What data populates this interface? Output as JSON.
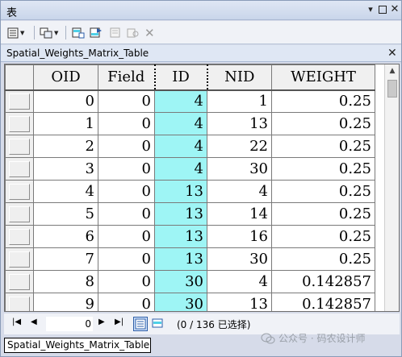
{
  "window": {
    "title": "表"
  },
  "toolbar": {
    "buttons": [
      {
        "icon": "table-options-icon"
      },
      {
        "icon": "related-tables-icon"
      },
      {
        "icon": "select-by-attributes-icon"
      },
      {
        "icon": "switch-selection-icon"
      },
      {
        "icon": "clear-selection-icon"
      },
      {
        "icon": "zoom-to-selected-icon"
      },
      {
        "icon": "delete-selected-icon"
      }
    ]
  },
  "tab": {
    "title": "Spatial_Weights_Matrix_Table"
  },
  "grid": {
    "columns": [
      "OID",
      "Field",
      "ID",
      "NID",
      "WEIGHT"
    ],
    "selected_column": "ID",
    "rows": [
      [
        "0",
        "0",
        "4",
        "1",
        "0.25"
      ],
      [
        "1",
        "0",
        "4",
        "13",
        "0.25"
      ],
      [
        "2",
        "0",
        "4",
        "22",
        "0.25"
      ],
      [
        "3",
        "0",
        "4",
        "30",
        "0.25"
      ],
      [
        "4",
        "0",
        "13",
        "4",
        "0.25"
      ],
      [
        "5",
        "0",
        "13",
        "14",
        "0.25"
      ],
      [
        "6",
        "0",
        "13",
        "16",
        "0.25"
      ],
      [
        "7",
        "0",
        "13",
        "30",
        "0.25"
      ],
      [
        "8",
        "0",
        "30",
        "4",
        "0.142857"
      ],
      [
        "9",
        "0",
        "30",
        "13",
        "0.142857"
      ]
    ]
  },
  "navigation": {
    "current_record": "0",
    "status": "(0 / 136 已选择)"
  },
  "watermark": "公众号 · 码农设计师",
  "bottom_tab": {
    "label": "Spatial_Weights_Matrix_Table"
  },
  "colors": {
    "selected_column_bg": "#9ef5f5",
    "window_frame": "#d6dbe9"
  }
}
